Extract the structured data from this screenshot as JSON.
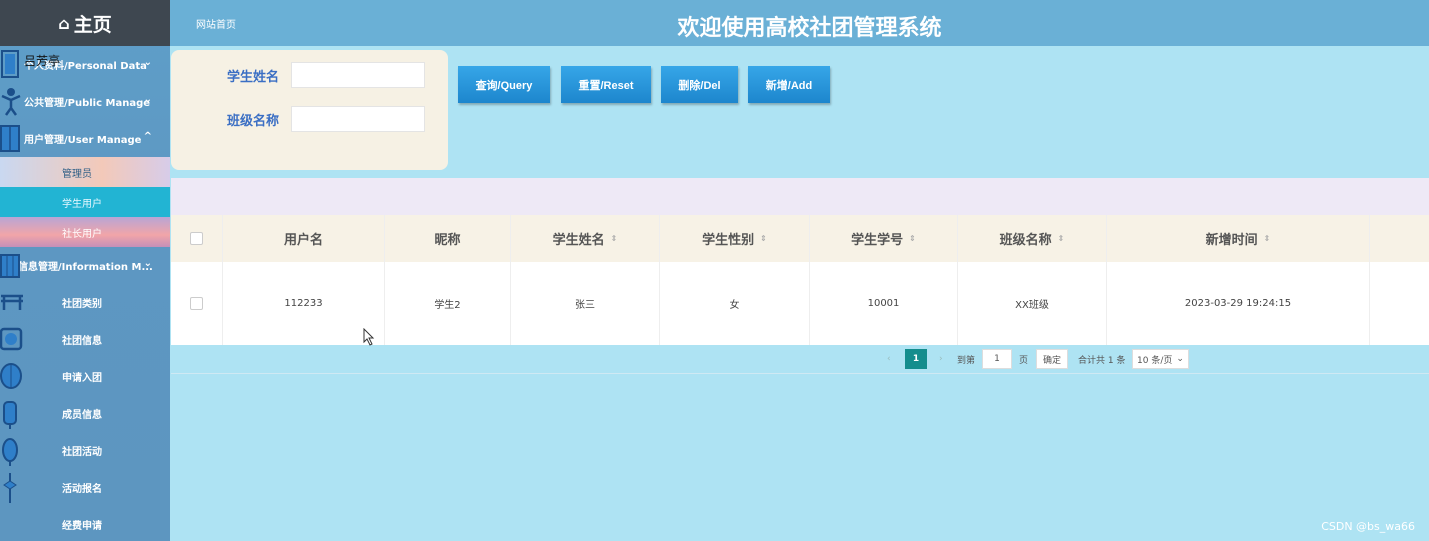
{
  "sidebar": {
    "header": "主页",
    "home_icon": "⌂",
    "floating_user": "吕芳亭",
    "menus": [
      {
        "label": "个人资料/Personal Data",
        "caret": "⌄"
      },
      {
        "label": "公共管理/Public Manage",
        "caret": "⌄"
      },
      {
        "label": "用户管理/User Manage",
        "caret": "^"
      }
    ],
    "user_submenu": [
      "管理员",
      "学生用户",
      "社长用户"
    ],
    "info_menu": {
      "label": "信息管理/Information M...",
      "caret": "⌄"
    },
    "info_items": [
      "社团类别",
      "社团信息",
      "申请入团",
      "成员信息",
      "社团活动",
      "活动报名",
      "经费申请"
    ]
  },
  "header": {
    "home_link": "网站首页",
    "title": "欢迎使用高校社团管理系统"
  },
  "search": {
    "name_label": "学生姓名",
    "name_value": "",
    "class_label": "班级名称",
    "class_value": ""
  },
  "buttons": {
    "query": "查询/Query",
    "reset": "重置/Reset",
    "delete": "删除/Del",
    "add": "新增/Add"
  },
  "table": {
    "columns": [
      "用户名",
      "昵称",
      "学生姓名",
      "学生性别",
      "学生学号",
      "班级名称",
      "新增时间"
    ],
    "sort_icon": "⇕",
    "rows": [
      {
        "username": "112233",
        "nickname": "学生2",
        "name": "张三",
        "gender": "女",
        "student_no": "10001",
        "class": "XX班级",
        "created": "2023-03-29 19:24:15"
      }
    ]
  },
  "pagination": {
    "prev": "‹",
    "current_page": "1",
    "next": "›",
    "goto_label": "到第",
    "goto_value": "1",
    "page_unit": "页",
    "confirm": "确定",
    "total": "合计共 1 条",
    "page_size": "10 条/页"
  },
  "watermark": "CSDN @bs_wa66",
  "colors": {
    "sidebar": "#5f9fc9",
    "header_bar": "#6ab0d6",
    "page_bg": "#aee3f3",
    "button": "#1d86cd",
    "active_page": "#148d8d",
    "label_blue": "#3b6fc4"
  }
}
